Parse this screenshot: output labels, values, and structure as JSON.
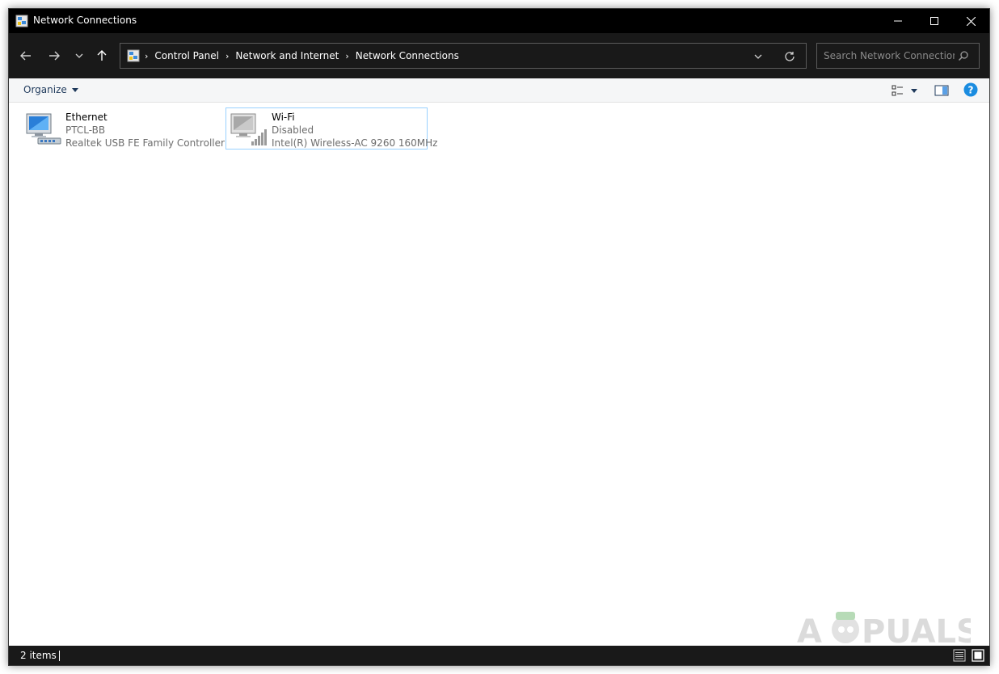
{
  "window": {
    "title": "Network Connections"
  },
  "nav": {
    "breadcrumbs": [
      "Control Panel",
      "Network and Internet",
      "Network Connections"
    ],
    "search_placeholder": "Search Network Connections"
  },
  "toolbar": {
    "organize_label": "Organize"
  },
  "connections": [
    {
      "name": "Ethernet",
      "status": "PTCL-BB",
      "device": "Realtek USB FE Family Controller"
    },
    {
      "name": "Wi-Fi",
      "status": "Disabled",
      "device": "Intel(R) Wireless-AC 9260 160MHz"
    }
  ],
  "status_bar": {
    "item_count": "2 items"
  },
  "watermark": {
    "text": "APPUALS"
  },
  "colors": {
    "dark_bar": "#191919",
    "title_bar": "#000000",
    "selection_border": "#99d1ff",
    "help_blue": "#1a8ce0",
    "organize_text": "#1e395b"
  },
  "icons": {
    "back": "arrow-left-icon",
    "forward": "arrow-right-icon",
    "recent": "chevron-down-icon",
    "up": "arrow-up-icon",
    "refresh": "refresh-icon",
    "search": "search-icon",
    "help": "help-icon",
    "ethernet": "ethernet-adapter-icon",
    "wifi": "wifi-adapter-icon"
  }
}
